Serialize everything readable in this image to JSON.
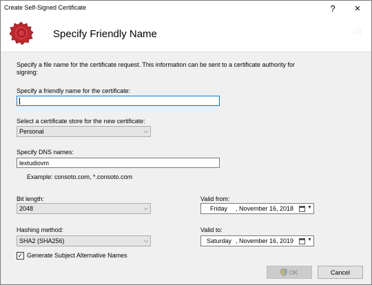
{
  "window": {
    "title": "Create Self-Signed Certificate",
    "help_glyph": "?",
    "close_glyph": "✕",
    "ghost_text": "- □"
  },
  "header": {
    "title": "Specify Friendly Name",
    "icon": "certificate-seal-icon",
    "seal_color": "#c0262d"
  },
  "form": {
    "description": "Specify a file name for the certificate request. This information can be sent to a certificate authority for signing:",
    "friendly_name": {
      "label": "Specify a friendly name for the certificate:",
      "value": ""
    },
    "store": {
      "label": "Select a certificate store for the new certificate:",
      "value": "Personal"
    },
    "dns": {
      "label": "Specify DNS names:",
      "value": "lextudiovm",
      "example": "Example: consoto.com, *.consoto.com"
    },
    "bit_length": {
      "label": "Bit length:",
      "value": "2048"
    },
    "hashing": {
      "label": "Hashing method:",
      "value": "SHA2 (SHA256)"
    },
    "valid_from": {
      "label": "Valid from:",
      "day": "Friday",
      "sep": ",",
      "date": "November 16, 2018"
    },
    "valid_to": {
      "label": "Valid to:",
      "day": "Saturday",
      "sep": ",",
      "date": "November 16, 2019"
    },
    "san": {
      "label": "Generate Subject Alternative Names",
      "checked": true,
      "check_glyph": "✓"
    }
  },
  "buttons": {
    "ok": "OK",
    "cancel": "Cancel"
  },
  "colors": {
    "focus_border": "#0078d7",
    "body_bg": "#f0f0f0"
  }
}
